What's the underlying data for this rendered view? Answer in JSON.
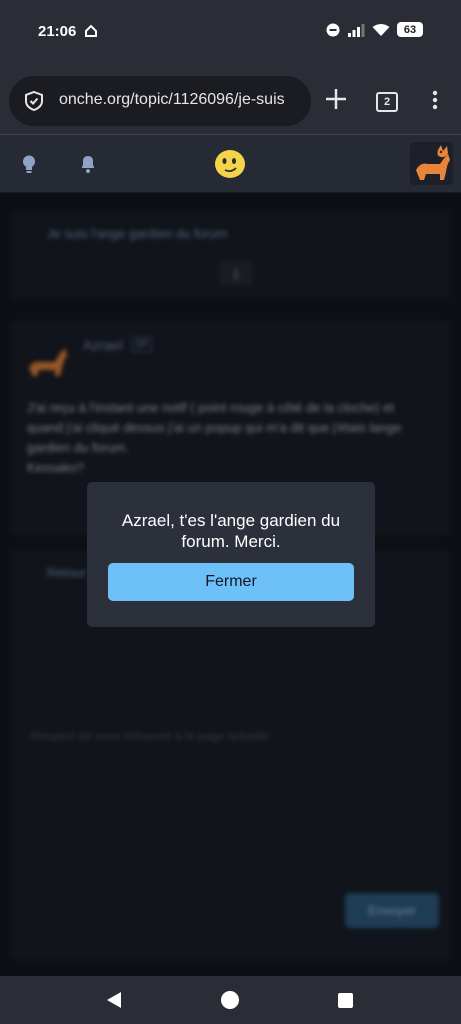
{
  "status_bar": {
    "time": "21:06",
    "battery": "63"
  },
  "browser": {
    "url": "onche.org/topic/1126096/je-suis",
    "tab_count": "2"
  },
  "page": {
    "topic_title": "Je suis l'ange gardien du forum",
    "page_number": "1",
    "post": {
      "author": "Azrael",
      "badge": "SP",
      "message": "J'ai reçu à l'instant une notif ( point rouge à côté de la cloche) et quand j'ai cliqué dessus j'ai un popup qui m'a dit que j'étais lange gardien du forum.\nKessako?"
    },
    "reply": {
      "label": "Retour",
      "placeholder": "Respect de vous retrouver à la page actuelle",
      "send_label": "Envoyer"
    }
  },
  "modal": {
    "message": "Azrael, t'es l'ange gardien du forum. Merci.",
    "button_label": "Fermer"
  },
  "colors": {
    "accent": "#6ec0f8",
    "background": "#141821",
    "card": "#1b1f29"
  }
}
